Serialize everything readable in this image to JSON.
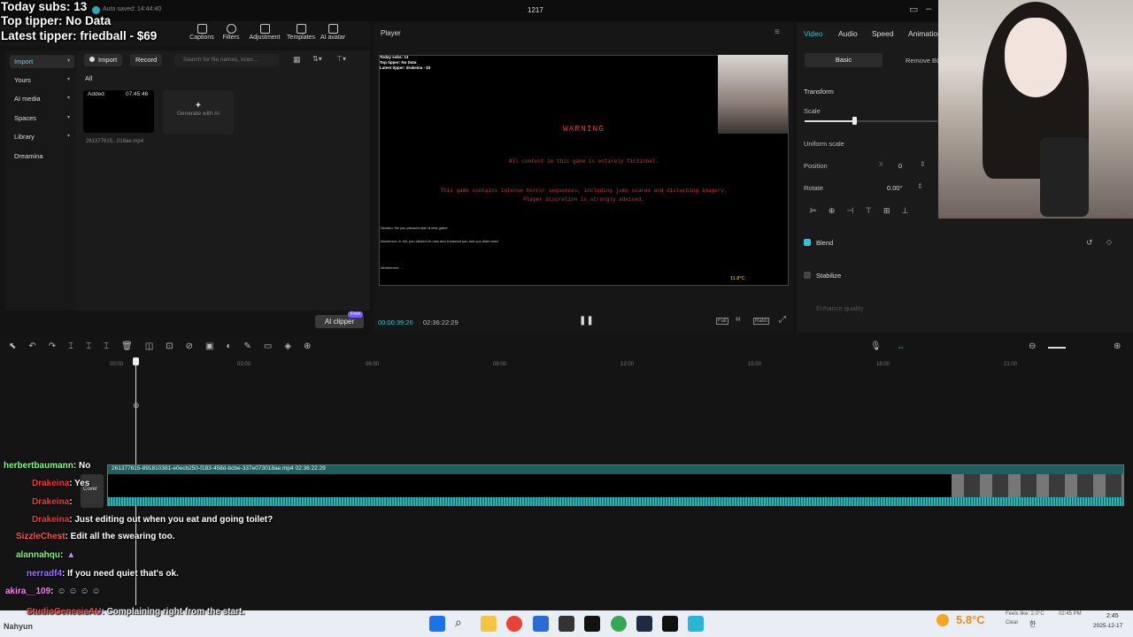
{
  "overlay": {
    "today_subs": "Today subs: 13",
    "top_tipper": "Top tipper: No Data",
    "latest_tipper": "Latest tipper: friedball - $69"
  },
  "app": {
    "autosave": "Auto saved: 14:44:40",
    "project_title": "1217"
  },
  "toolbar": [
    "Captions",
    "Filters",
    "Adjustment",
    "Templates",
    "AI avatar"
  ],
  "leftnav": [
    "Import",
    "Yours",
    "AI media",
    "Spaces",
    "Library",
    "Dreamina"
  ],
  "media": {
    "import_btn": "Import",
    "record_btn": "Record",
    "search_placeholder": "Search for file names, scen...",
    "filter_all": "All",
    "clip_status": "Added",
    "clip_duration": "07:45:46",
    "clip_name": "261377615...018ae.mp4",
    "generate": "Generate with AI",
    "ai_clipper": "AI clipper",
    "free_badge": "Free"
  },
  "player": {
    "title": "Player",
    "warning": "WARNING",
    "line1": "All content in this game is entirely fictional.",
    "line2": "This game contains intense horror sequences, including jump scares and disturbing imagery.",
    "line3": "Player discretion is strongly advised.",
    "mini_overlay": [
      "Today subs: 13",
      "Top tipper: No Data",
      "Latest tipper: drakeina - $3"
    ],
    "mini_chat": [
      "Newton: No you pressed start a new game",
      "kilumimon: in did, you clicked on new and it warned you and you didnt read",
      "Alumberoni: ..."
    ],
    "weather_mini": "11.8°C",
    "current_time": "00:00:39:26",
    "total_time": "02:36:22:29",
    "full_label": "Full",
    "ratio_label": "Ratio"
  },
  "properties": {
    "tabs": [
      "Video",
      "Audio",
      "Speed",
      "Animation"
    ],
    "sub_tabs": [
      "Basic",
      "Remove BG"
    ],
    "transform": "Transform",
    "scale": "Scale",
    "uniform_scale": "Uniform scale",
    "position": "Position",
    "position_x_label": "X",
    "position_x": "0",
    "rotate": "Rotate",
    "rotate_val": "0.00°",
    "blend": "Blend",
    "stabilize": "Stabilize",
    "enhance": "Enhance quality",
    "scale_level": 0.37
  },
  "timeline": {
    "ticks": [
      "00:00",
      "03:00",
      "06:00",
      "09:00",
      "12:00",
      "15:00",
      "18:00",
      "21:00"
    ],
    "clip_label": "261377615-891810381-e0ecb250-f183-458d-bcbe-337e073018ae.mp4   02:36:22:29",
    "cover": "Cover"
  },
  "chat": [
    {
      "user": "herbertbaumann",
      "msg": ": No",
      "color": "#7fff7f"
    },
    {
      "user": "Drakeina",
      "msg": ": Yes",
      "color": "#ff3030"
    },
    {
      "user": "Drakeina",
      "msg": ":",
      "color": "#ff3030"
    },
    {
      "user": "Drakeina",
      "msg": ": Just editing out when you eat and going toilet?",
      "color": "#ff3030"
    },
    {
      "user": "SizzleChest",
      "msg": ": Edit all the swearing too.",
      "color": "#ff5050"
    },
    {
      "user": "alannahqu",
      "msg": ":",
      "color": "#6cff6c"
    },
    {
      "user": "nerradf4",
      "msg": ": If you need quiet that's ok.",
      "color": "#a070ff"
    },
    {
      "user": "akira__109",
      "msg": ":",
      "color": "#ff7fff"
    },
    {
      "user": "StudioGenesisAU",
      "msg": ": Complaining right from the start.",
      "color": "#ff4040"
    },
    {
      "user": "Nahyun",
      "msg": "",
      "color": "#dddddd"
    }
  ],
  "taskbar": {
    "weather": "5.8°C",
    "feels": "Feels like: 2.0°C",
    "cond": "Clear",
    "time_mini": "02:45 PM",
    "lang": "한",
    "clock": "2:45",
    "date": "2025-12-17"
  }
}
